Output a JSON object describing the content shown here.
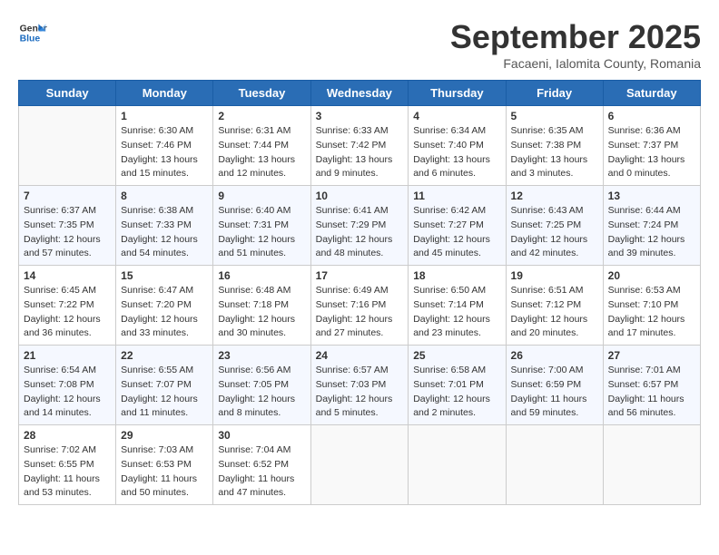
{
  "header": {
    "logo_general": "General",
    "logo_blue": "Blue",
    "month_title": "September 2025",
    "location": "Facaeni, Ialomita County, Romania"
  },
  "days_of_week": [
    "Sunday",
    "Monday",
    "Tuesday",
    "Wednesday",
    "Thursday",
    "Friday",
    "Saturday"
  ],
  "weeks": [
    [
      {
        "day": "",
        "data": ""
      },
      {
        "day": "1",
        "sunrise": "Sunrise: 6:30 AM",
        "sunset": "Sunset: 7:46 PM",
        "daylight": "Daylight: 13 hours and 15 minutes."
      },
      {
        "day": "2",
        "sunrise": "Sunrise: 6:31 AM",
        "sunset": "Sunset: 7:44 PM",
        "daylight": "Daylight: 13 hours and 12 minutes."
      },
      {
        "day": "3",
        "sunrise": "Sunrise: 6:33 AM",
        "sunset": "Sunset: 7:42 PM",
        "daylight": "Daylight: 13 hours and 9 minutes."
      },
      {
        "day": "4",
        "sunrise": "Sunrise: 6:34 AM",
        "sunset": "Sunset: 7:40 PM",
        "daylight": "Daylight: 13 hours and 6 minutes."
      },
      {
        "day": "5",
        "sunrise": "Sunrise: 6:35 AM",
        "sunset": "Sunset: 7:38 PM",
        "daylight": "Daylight: 13 hours and 3 minutes."
      },
      {
        "day": "6",
        "sunrise": "Sunrise: 6:36 AM",
        "sunset": "Sunset: 7:37 PM",
        "daylight": "Daylight: 13 hours and 0 minutes."
      }
    ],
    [
      {
        "day": "7",
        "sunrise": "Sunrise: 6:37 AM",
        "sunset": "Sunset: 7:35 PM",
        "daylight": "Daylight: 12 hours and 57 minutes."
      },
      {
        "day": "8",
        "sunrise": "Sunrise: 6:38 AM",
        "sunset": "Sunset: 7:33 PM",
        "daylight": "Daylight: 12 hours and 54 minutes."
      },
      {
        "day": "9",
        "sunrise": "Sunrise: 6:40 AM",
        "sunset": "Sunset: 7:31 PM",
        "daylight": "Daylight: 12 hours and 51 minutes."
      },
      {
        "day": "10",
        "sunrise": "Sunrise: 6:41 AM",
        "sunset": "Sunset: 7:29 PM",
        "daylight": "Daylight: 12 hours and 48 minutes."
      },
      {
        "day": "11",
        "sunrise": "Sunrise: 6:42 AM",
        "sunset": "Sunset: 7:27 PM",
        "daylight": "Daylight: 12 hours and 45 minutes."
      },
      {
        "day": "12",
        "sunrise": "Sunrise: 6:43 AM",
        "sunset": "Sunset: 7:25 PM",
        "daylight": "Daylight: 12 hours and 42 minutes."
      },
      {
        "day": "13",
        "sunrise": "Sunrise: 6:44 AM",
        "sunset": "Sunset: 7:24 PM",
        "daylight": "Daylight: 12 hours and 39 minutes."
      }
    ],
    [
      {
        "day": "14",
        "sunrise": "Sunrise: 6:45 AM",
        "sunset": "Sunset: 7:22 PM",
        "daylight": "Daylight: 12 hours and 36 minutes."
      },
      {
        "day": "15",
        "sunrise": "Sunrise: 6:47 AM",
        "sunset": "Sunset: 7:20 PM",
        "daylight": "Daylight: 12 hours and 33 minutes."
      },
      {
        "day": "16",
        "sunrise": "Sunrise: 6:48 AM",
        "sunset": "Sunset: 7:18 PM",
        "daylight": "Daylight: 12 hours and 30 minutes."
      },
      {
        "day": "17",
        "sunrise": "Sunrise: 6:49 AM",
        "sunset": "Sunset: 7:16 PM",
        "daylight": "Daylight: 12 hours and 27 minutes."
      },
      {
        "day": "18",
        "sunrise": "Sunrise: 6:50 AM",
        "sunset": "Sunset: 7:14 PM",
        "daylight": "Daylight: 12 hours and 23 minutes."
      },
      {
        "day": "19",
        "sunrise": "Sunrise: 6:51 AM",
        "sunset": "Sunset: 7:12 PM",
        "daylight": "Daylight: 12 hours and 20 minutes."
      },
      {
        "day": "20",
        "sunrise": "Sunrise: 6:53 AM",
        "sunset": "Sunset: 7:10 PM",
        "daylight": "Daylight: 12 hours and 17 minutes."
      }
    ],
    [
      {
        "day": "21",
        "sunrise": "Sunrise: 6:54 AM",
        "sunset": "Sunset: 7:08 PM",
        "daylight": "Daylight: 12 hours and 14 minutes."
      },
      {
        "day": "22",
        "sunrise": "Sunrise: 6:55 AM",
        "sunset": "Sunset: 7:07 PM",
        "daylight": "Daylight: 12 hours and 11 minutes."
      },
      {
        "day": "23",
        "sunrise": "Sunrise: 6:56 AM",
        "sunset": "Sunset: 7:05 PM",
        "daylight": "Daylight: 12 hours and 8 minutes."
      },
      {
        "day": "24",
        "sunrise": "Sunrise: 6:57 AM",
        "sunset": "Sunset: 7:03 PM",
        "daylight": "Daylight: 12 hours and 5 minutes."
      },
      {
        "day": "25",
        "sunrise": "Sunrise: 6:58 AM",
        "sunset": "Sunset: 7:01 PM",
        "daylight": "Daylight: 12 hours and 2 minutes."
      },
      {
        "day": "26",
        "sunrise": "Sunrise: 7:00 AM",
        "sunset": "Sunset: 6:59 PM",
        "daylight": "Daylight: 11 hours and 59 minutes."
      },
      {
        "day": "27",
        "sunrise": "Sunrise: 7:01 AM",
        "sunset": "Sunset: 6:57 PM",
        "daylight": "Daylight: 11 hours and 56 minutes."
      }
    ],
    [
      {
        "day": "28",
        "sunrise": "Sunrise: 7:02 AM",
        "sunset": "Sunset: 6:55 PM",
        "daylight": "Daylight: 11 hours and 53 minutes."
      },
      {
        "day": "29",
        "sunrise": "Sunrise: 7:03 AM",
        "sunset": "Sunset: 6:53 PM",
        "daylight": "Daylight: 11 hours and 50 minutes."
      },
      {
        "day": "30",
        "sunrise": "Sunrise: 7:04 AM",
        "sunset": "Sunset: 6:52 PM",
        "daylight": "Daylight: 11 hours and 47 minutes."
      },
      {
        "day": "",
        "data": ""
      },
      {
        "day": "",
        "data": ""
      },
      {
        "day": "",
        "data": ""
      },
      {
        "day": "",
        "data": ""
      }
    ]
  ]
}
